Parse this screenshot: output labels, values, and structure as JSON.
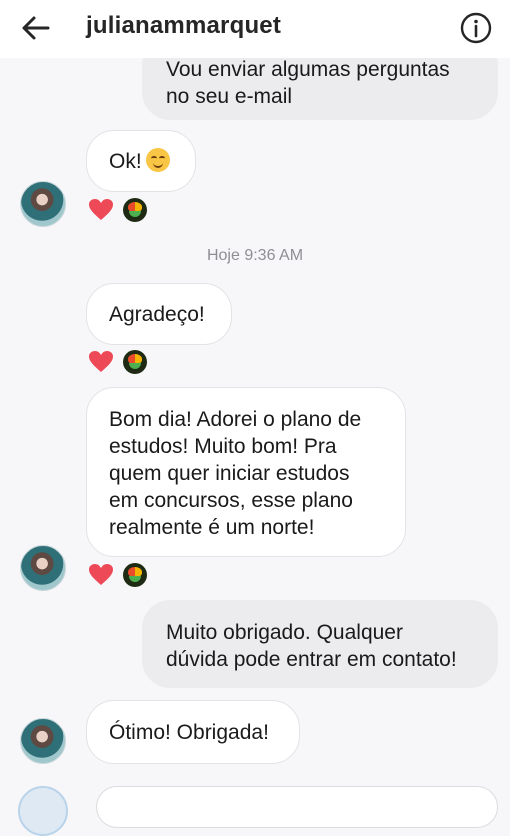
{
  "header": {
    "title": "julianammarquet"
  },
  "messages": [
    {
      "id": "m1",
      "direction": "sent",
      "lines": [
        "Vou enviar algumas perguntas",
        "no seu e-mail"
      ]
    },
    {
      "id": "m2",
      "direction": "received",
      "text": "Ok!",
      "emoji": "smiling-face",
      "reactions": [
        "heart",
        "profile-badge"
      ]
    },
    {
      "id": "m3",
      "direction": "received",
      "text": "Agradeço!",
      "reactions": [
        "heart",
        "profile-badge"
      ]
    },
    {
      "id": "m4",
      "direction": "received",
      "lines": [
        "Bom dia! Adorei o plano de",
        "estudos! Muito bom! Pra",
        "quem quer iniciar estudos",
        "em concursos, esse plano",
        "realmente é um norte!"
      ],
      "reactions": [
        "heart",
        "profile-badge"
      ]
    },
    {
      "id": "m5",
      "direction": "sent",
      "lines": [
        "Muito obrigado. Qualquer",
        "dúvida pode entrar em contato!"
      ]
    },
    {
      "id": "m6",
      "direction": "received",
      "text": "Ótimo! Obrigada!"
    }
  ],
  "timestamp": "Hoje 9:36 AM",
  "colors": {
    "heart": "#ed4956",
    "sent_bubble": "#ececef",
    "received_bubble": "#ffffff",
    "background": "#f7f7fa"
  }
}
